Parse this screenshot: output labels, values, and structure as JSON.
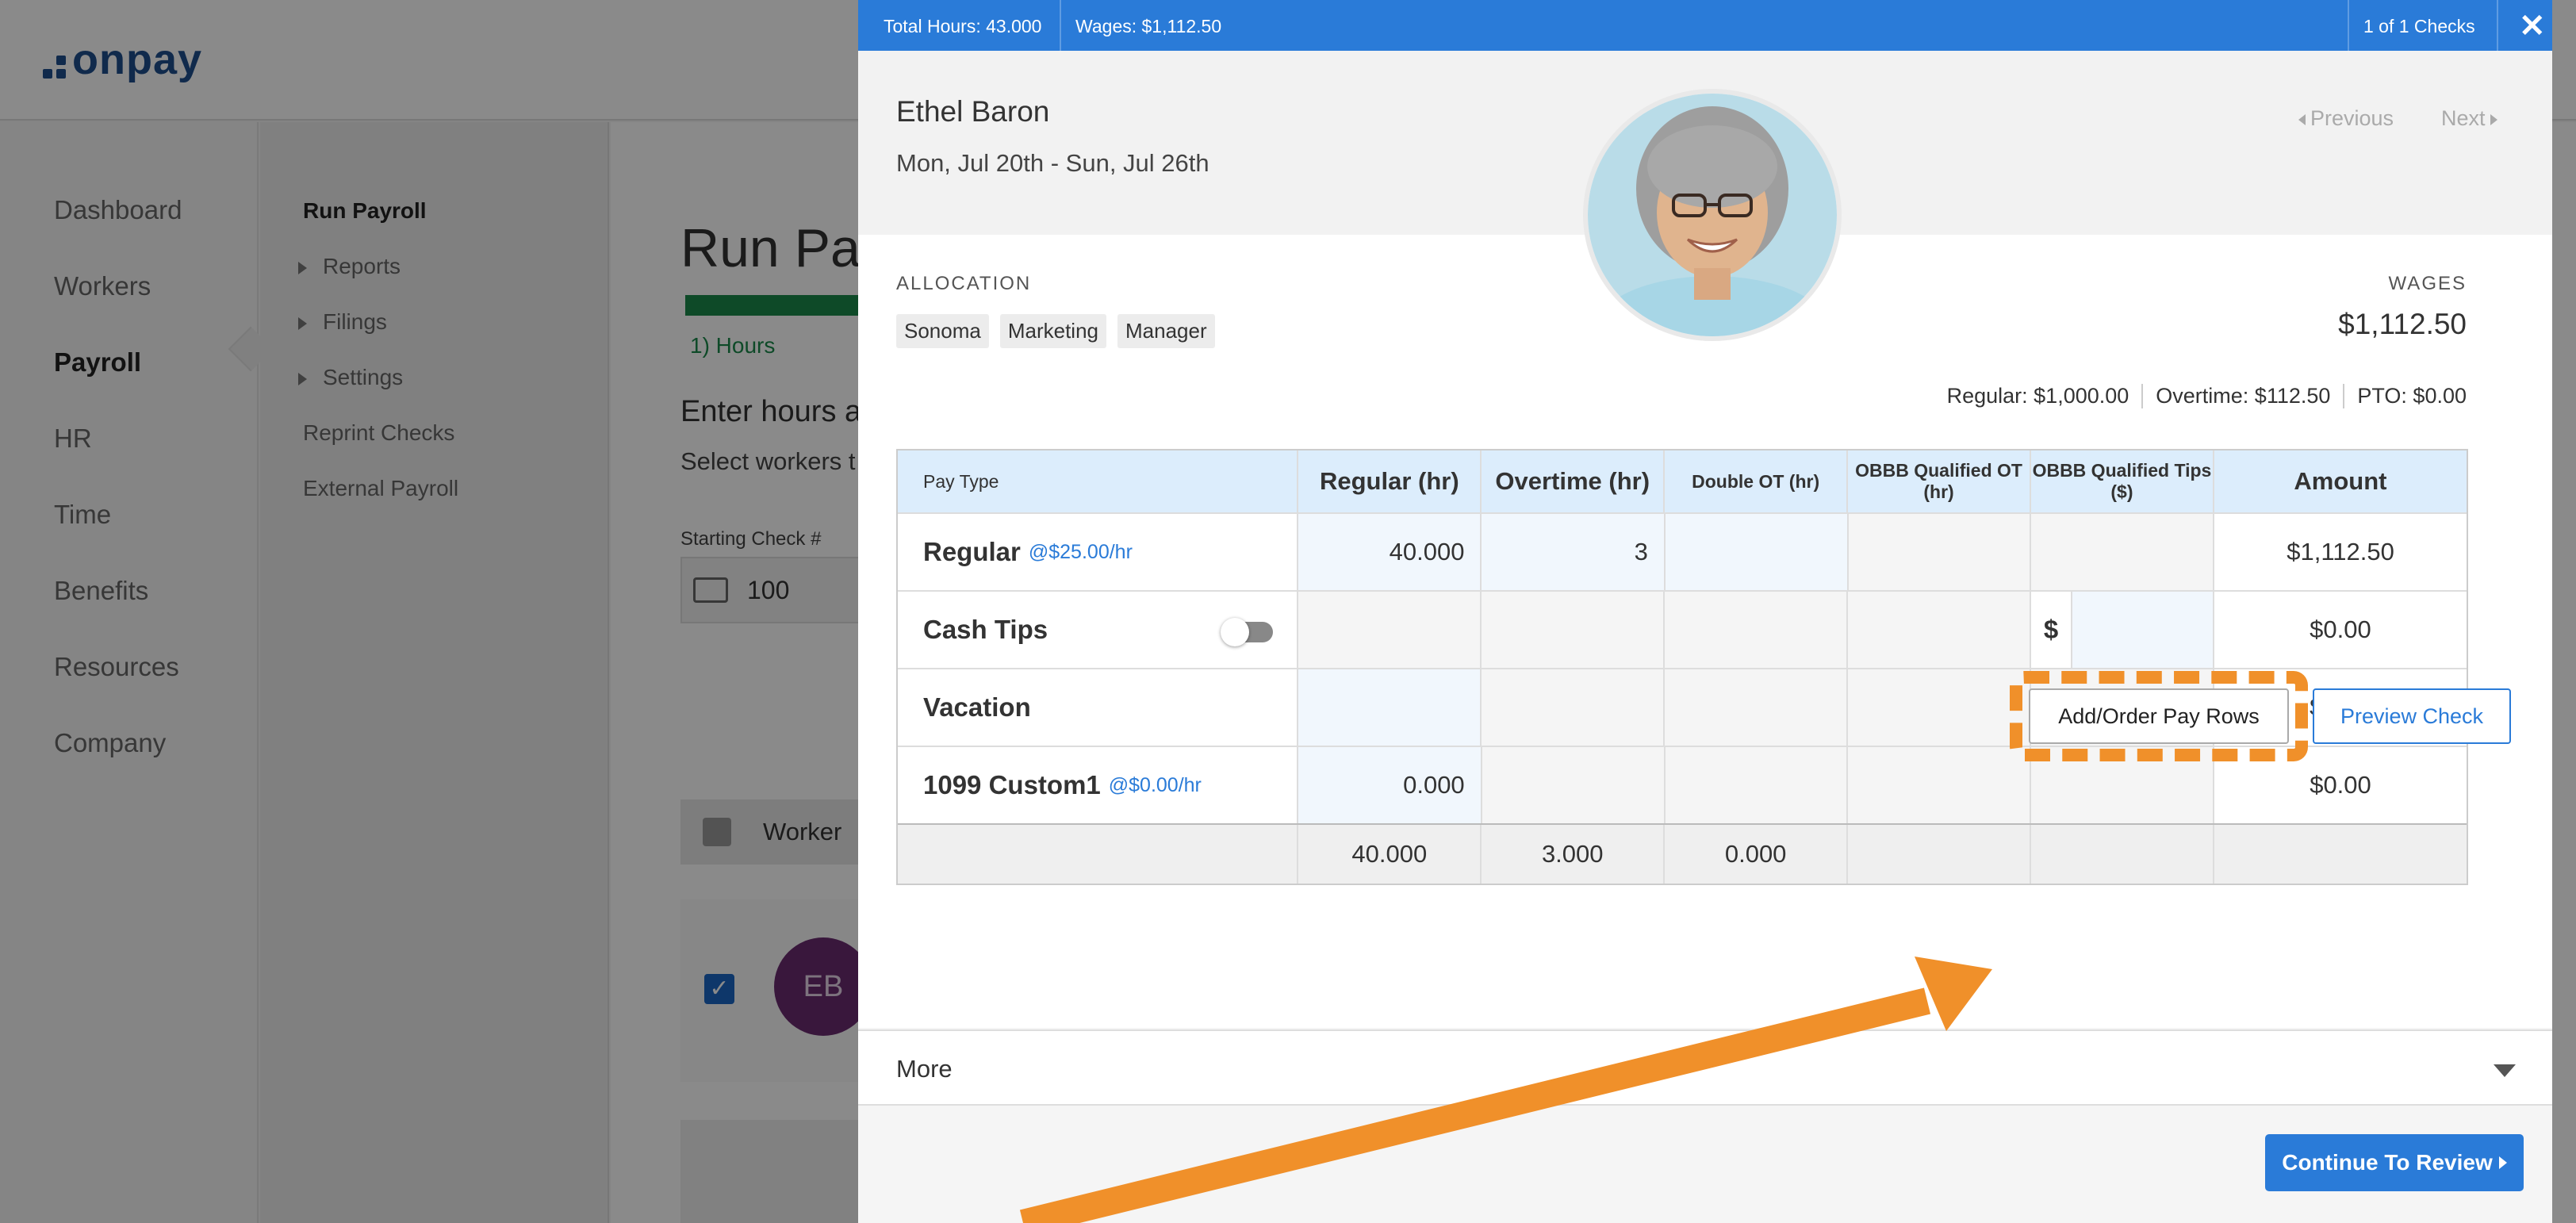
{
  "app": {
    "logo": "onpay",
    "nav": [
      "Dashboard",
      "Workers",
      "Payroll",
      "HR",
      "Time",
      "Benefits",
      "Resources",
      "Company"
    ],
    "active_nav": "Payroll",
    "subnav": {
      "head": "Run Payroll",
      "items": [
        "Reports",
        "Filings",
        "Settings"
      ],
      "links": [
        "Reprint Checks",
        "External Payroll"
      ]
    },
    "main": {
      "title": "Run Pa",
      "step": "1) Hours",
      "enter_hours": "Enter hours a",
      "select_workers": "Select workers t",
      "starting_check_label": "Starting Check #",
      "starting_check_value": "100",
      "worker_column": "Worker",
      "avatar_initials": "EB"
    }
  },
  "modal": {
    "total_hours": "Total Hours: 43.000",
    "wages_header": "Wages: $1,112.50",
    "checks_count": "1 of 1 Checks",
    "close": "✕",
    "employee_name": "Ethel Baron",
    "date_range": "Mon, Jul 20th - Sun, Jul 26th",
    "previous": "Previous",
    "next": "Next",
    "allocation_label": "ALLOCATION",
    "allocation_chips": [
      "Sonoma",
      "Marketing",
      "Manager"
    ],
    "wages_label": "WAGES",
    "wages_value": "$1,112.50",
    "regular_summary": "Regular: $1,000.00",
    "overtime_summary": "Overtime: $112.50",
    "pto_summary": "PTO: $0.00",
    "table": {
      "headers": [
        "Pay Type",
        "Regular (hr)",
        "Overtime (hr)",
        "Double OT (hr)",
        "OBBB Qualified OT (hr)",
        "OBBB Qualified Tips ($)",
        "Amount"
      ],
      "rows": [
        {
          "name": "Regular",
          "rate": "@$25.00/hr",
          "regular": "40.000",
          "overtime": "3",
          "amount": "$1,112.50"
        },
        {
          "name": "Cash Tips",
          "tips_prefix": "$",
          "amount": "$0.00"
        },
        {
          "name": "Vacation",
          "amount": "$0.00"
        },
        {
          "name": "1099 Custom1",
          "rate": "@$0.00/hr",
          "regular": "0.000",
          "amount": "$0.00"
        }
      ],
      "totals": {
        "regular": "40.000",
        "overtime": "3.000",
        "double_ot": "0.000"
      }
    },
    "add_order_button": "Add/Order Pay Rows",
    "preview_button": "Preview Check",
    "more_label": "More",
    "continue_button": "Continue To Review"
  },
  "colors": {
    "brand": "#1f4e8c",
    "primary": "#2a7bd8",
    "highlight": "#f0902a",
    "success": "#1a8a4a"
  },
  "icons": {
    "close": "close-icon",
    "previous": "caret-left-icon",
    "next": "caret-right-icon",
    "more": "chevron-down-icon",
    "continue": "caret-right-icon",
    "check": "checkbook-icon"
  }
}
